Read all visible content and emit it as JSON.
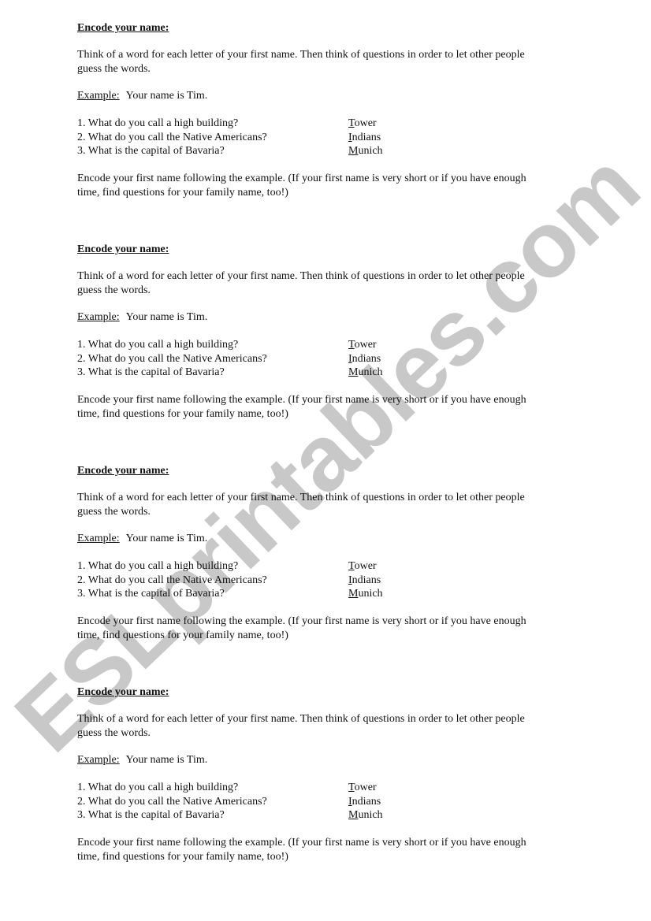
{
  "watermark": "ESLprintables.com",
  "sections": [
    {
      "heading": "Encode your name:",
      "intro_line1": "Think of a word for each letter of your first name. Then think of questions in order to let other people",
      "intro_line2": "guess the words.",
      "example_label": "Example:",
      "example_text": "Your name is Tim.",
      "questions": [
        {
          "q": "1. What do you call a high building?",
          "answer_first": "T",
          "answer_rest": "ower"
        },
        {
          "q": "2. What do you call the Native Americans?",
          "answer_first": "I",
          "answer_rest": "ndians"
        },
        {
          "q": "3. What is the capital of Bavaria?",
          "answer_first": "M",
          "answer_rest": "unich"
        }
      ],
      "closing_line1": "Encode your first name following the example. (If your first name is very short or if you have enough",
      "closing_line2": "time, find questions for your family name, too!)"
    },
    {
      "heading": "Encode your name:",
      "intro_line1": "Think of a word for each letter of your first name. Then think of questions in order to let other people",
      "intro_line2": "guess the words.",
      "example_label": "Example:",
      "example_text": "Your name is Tim.",
      "questions": [
        {
          "q": "1. What do you call a high building?",
          "answer_first": "T",
          "answer_rest": "ower"
        },
        {
          "q": "2. What do you call the Native Americans?",
          "answer_first": "I",
          "answer_rest": "ndians"
        },
        {
          "q": "3. What is the capital of Bavaria?",
          "answer_first": "M",
          "answer_rest": "unich"
        }
      ],
      "closing_line1": "Encode your first name following the example. (If your first name is very short or if you have enough",
      "closing_line2": "time, find questions for your family name, too!)"
    },
    {
      "heading": "Encode your name:",
      "intro_line1": "Think of a word for each letter of your first name. Then think of questions in order to let other people",
      "intro_line2": "guess the words.",
      "example_label": "Example:",
      "example_text": "Your name is Tim.",
      "questions": [
        {
          "q": "1. What do you call a high building?",
          "answer_first": "T",
          "answer_rest": "ower"
        },
        {
          "q": "2. What do you call the Native Americans?",
          "answer_first": "I",
          "answer_rest": "ndians"
        },
        {
          "q": "3. What is the capital of Bavaria?",
          "answer_first": "M",
          "answer_rest": "unich"
        }
      ],
      "closing_line1": "Encode your first name following the example. (If your first name is very short or if you have enough",
      "closing_line2": "time, find questions for your family name, too!)"
    },
    {
      "heading": "Encode your name:",
      "intro_line1": "Think of a word for each letter of your first name. Then think of questions in order to let other people",
      "intro_line2": "guess the words.",
      "example_label": "Example:",
      "example_text": "Your name is Tim.",
      "questions": [
        {
          "q": "1. What do you call a high building?",
          "answer_first": "T",
          "answer_rest": "ower"
        },
        {
          "q": "2. What do you call the Native Americans?",
          "answer_first": "I",
          "answer_rest": "ndians"
        },
        {
          "q": "3. What is the capital of Bavaria?",
          "answer_first": "M",
          "answer_rest": "unich"
        }
      ],
      "closing_line1": "Encode your first name following the example. (If your first name is very short or if you have enough",
      "closing_line2": "time, find questions for your family name, too!)"
    }
  ]
}
